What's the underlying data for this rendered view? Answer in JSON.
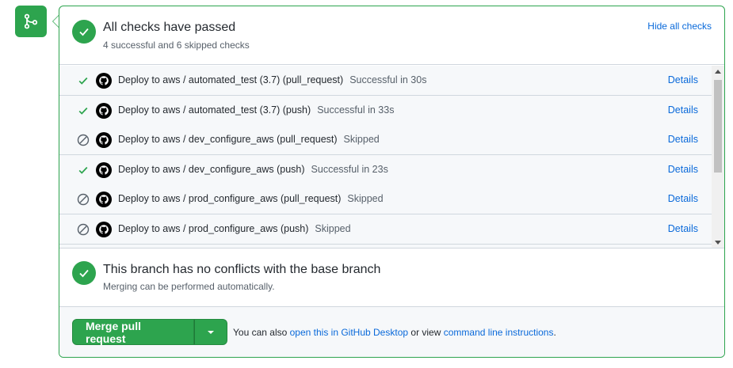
{
  "checks": {
    "title": "All checks have passed",
    "subtitle": "4 successful and 6 skipped checks",
    "hide_label": "Hide all checks",
    "items": [
      {
        "name": "Deploy to aws / automated_test (3.7) (pull_request)",
        "desc": "Successful in 30s",
        "status": "success",
        "details": "Details"
      },
      {
        "name": "Deploy to aws / automated_test (3.7) (push)",
        "desc": "Successful in 33s",
        "status": "success",
        "details": "Details"
      },
      {
        "name": "Deploy to aws / dev_configure_aws (pull_request)",
        "desc": "Skipped",
        "status": "skipped",
        "details": "Details"
      },
      {
        "name": "Deploy to aws / dev_configure_aws (push)",
        "desc": "Successful in 23s",
        "status": "success",
        "details": "Details"
      },
      {
        "name": "Deploy to aws / prod_configure_aws (pull_request)",
        "desc": "Skipped",
        "status": "skipped",
        "details": "Details"
      },
      {
        "name": "Deploy to aws / prod_configure_aws (push)",
        "desc": "Skipped",
        "status": "skipped",
        "details": "Details"
      }
    ]
  },
  "conflicts": {
    "title": "This branch has no conflicts with the base branch",
    "subtitle": "Merging can be performed automatically."
  },
  "merge": {
    "button_label": "Merge pull request",
    "text_prefix": "You can also",
    "desktop_link": "open this in GitHub Desktop",
    "text_middle": "or view",
    "cli_link": "command line instructions",
    "text_suffix": "."
  },
  "colors": {
    "success": "#2da44e",
    "link": "#0969da",
    "muted": "#57606a"
  },
  "icons": {
    "badge": "git-merge-icon",
    "success": "check-icon",
    "skipped": "skip-icon",
    "app": "github-logo-icon"
  }
}
